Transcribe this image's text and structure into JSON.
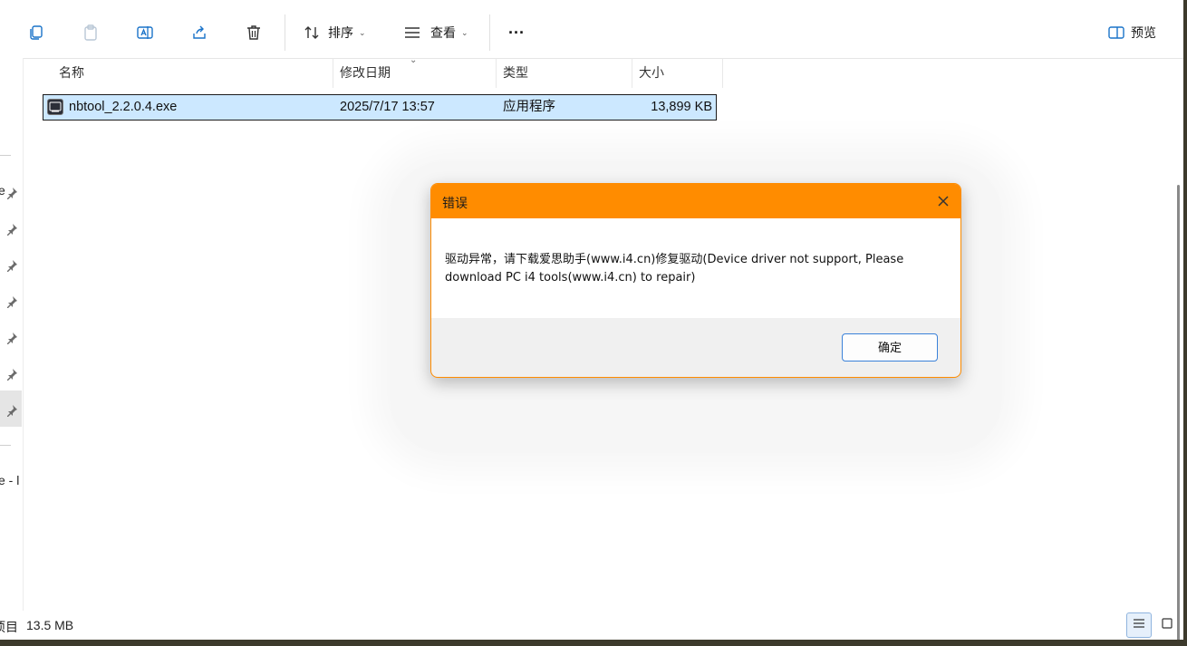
{
  "toolbar": {
    "sort_label": "排序",
    "view_label": "查看",
    "more_label": "···",
    "preview_label": "预览"
  },
  "nav": {
    "partial_texts": [
      "e",
      "e - l"
    ]
  },
  "columns": {
    "name": "名称",
    "modified": "修改日期",
    "type": "类型",
    "size": "大小"
  },
  "files": [
    {
      "name": "nbtool_2.2.0.4.exe",
      "modified": "2025/7/17 13:57",
      "type": "应用程序",
      "size": "13,899 KB"
    }
  ],
  "status": {
    "selection_label": "项目",
    "selection_size": "13.5 MB"
  },
  "dialog": {
    "title": "错误",
    "message": "驱动异常，请下载爱思助手(www.i4.cn)修复驱动(Device driver not support, Please download PC i4 tools(www.i4.cn) to repair)",
    "ok_label": "确定"
  },
  "colors": {
    "dialog_accent": "#ff8c00",
    "selection": "#cce8ff",
    "ok_border": "#3b82d9"
  }
}
